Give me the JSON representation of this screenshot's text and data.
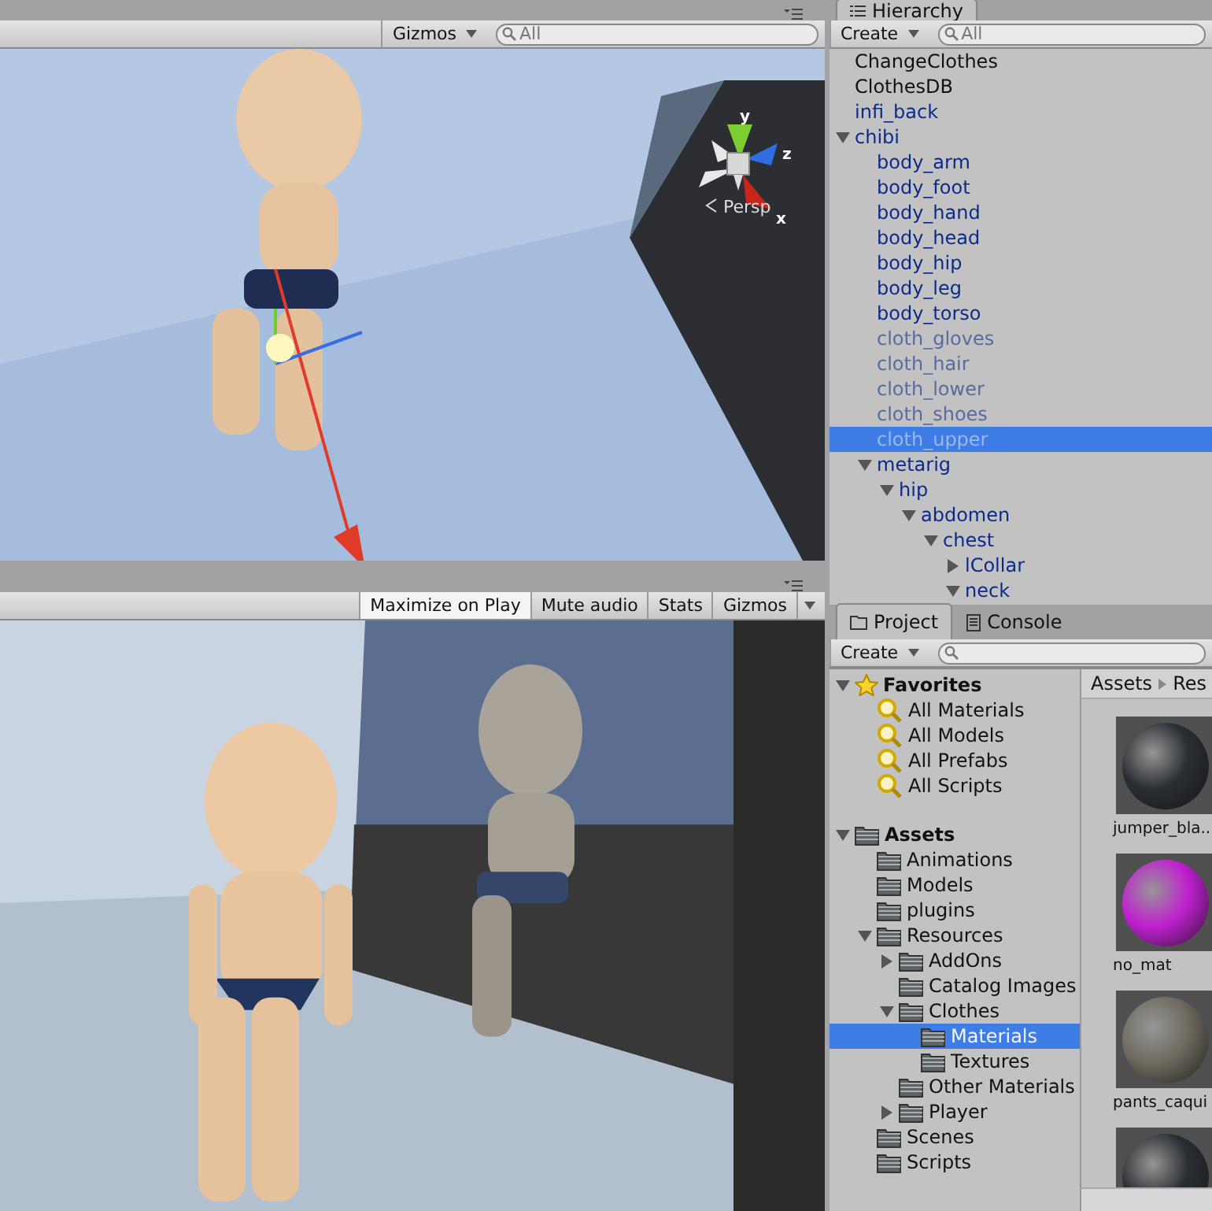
{
  "scene": {
    "toolbar": {
      "gizmos": "Gizmos",
      "search": "All"
    },
    "gizmo_labels": {
      "y": "y",
      "z": "z",
      "x": "x"
    },
    "projection": "Persp"
  },
  "game": {
    "buttons": [
      {
        "label": "Maximize on Play",
        "selected": true
      },
      {
        "label": "Mute audio",
        "selected": false
      },
      {
        "label": "Stats",
        "selected": false
      },
      {
        "label": "Gizmos",
        "selected": false,
        "dropdown": true
      }
    ]
  },
  "hierarchy": {
    "tab": "Hierarchy",
    "create": "Create",
    "search": "All",
    "items": [
      {
        "label": "ChangeClothes",
        "kind": "object"
      },
      {
        "label": "ClothesDB",
        "kind": "object"
      },
      {
        "label": "infi_back",
        "kind": "prefab"
      },
      {
        "label": "chibi",
        "kind": "prefab",
        "expanded": true,
        "children": [
          {
            "label": "body_arm",
            "kind": "prefab"
          },
          {
            "label": "body_foot",
            "kind": "prefab"
          },
          {
            "label": "body_hand",
            "kind": "prefab"
          },
          {
            "label": "body_head",
            "kind": "prefab"
          },
          {
            "label": "body_hip",
            "kind": "prefab"
          },
          {
            "label": "body_leg",
            "kind": "prefab"
          },
          {
            "label": "body_torso",
            "kind": "prefab"
          },
          {
            "label": "cloth_gloves",
            "kind": "inactive"
          },
          {
            "label": "cloth_hair",
            "kind": "inactive"
          },
          {
            "label": "cloth_lower",
            "kind": "inactive"
          },
          {
            "label": "cloth_shoes",
            "kind": "inactive"
          },
          {
            "label": "cloth_upper",
            "kind": "inactive",
            "selected": true
          },
          {
            "label": "metarig",
            "kind": "prefab",
            "expanded": true,
            "children": [
              {
                "label": "hip",
                "kind": "prefab",
                "expanded": true,
                "children": [
                  {
                    "label": "abdomen",
                    "kind": "prefab",
                    "expanded": true,
                    "children": [
                      {
                        "label": "chest",
                        "kind": "prefab",
                        "expanded": true,
                        "children": [
                          {
                            "label": "lCollar",
                            "kind": "prefab",
                            "expanded": false
                          },
                          {
                            "label": "neck",
                            "kind": "prefab",
                            "expanded": true
                          }
                        ]
                      }
                    ]
                  }
                ]
              }
            ]
          }
        ]
      }
    ]
  },
  "project": {
    "tabs": [
      {
        "label": "Project",
        "selected": true
      },
      {
        "label": "Console",
        "selected": false
      }
    ],
    "create": "Create",
    "tree": [
      {
        "label": "Favorites",
        "kind": "favorites",
        "expanded": true,
        "children": [
          {
            "label": "All Materials",
            "kind": "search"
          },
          {
            "label": "All Models",
            "kind": "search"
          },
          {
            "label": "All Prefabs",
            "kind": "search"
          },
          {
            "label": "All Scripts",
            "kind": "search"
          }
        ]
      },
      {
        "label": "Assets",
        "kind": "root",
        "expanded": true,
        "children": [
          {
            "label": "Animations",
            "kind": "folder"
          },
          {
            "label": "Models",
            "kind": "folder"
          },
          {
            "label": "plugins",
            "kind": "folder"
          },
          {
            "label": "Resources",
            "kind": "folder",
            "expanded": true,
            "children": [
              {
                "label": "AddOns",
                "kind": "folder",
                "expanded": false
              },
              {
                "label": "Catalog Images",
                "kind": "folder"
              },
              {
                "label": "Clothes",
                "kind": "folder",
                "expanded": true,
                "children": [
                  {
                    "label": "Materials",
                    "kind": "folder",
                    "selected": true
                  },
                  {
                    "label": "Textures",
                    "kind": "folder"
                  }
                ]
              },
              {
                "label": "Other Materials",
                "kind": "folder"
              },
              {
                "label": "Player",
                "kind": "folder",
                "expanded": false
              }
            ]
          },
          {
            "label": "Scenes",
            "kind": "folder"
          },
          {
            "label": "Scripts",
            "kind": "folder"
          }
        ]
      }
    ],
    "breadcrumb": [
      "Assets",
      "Res"
    ],
    "assets": [
      {
        "label": "jumper_bla...",
        "color": "#2a2e33"
      },
      {
        "label": "no_mat",
        "color": "#c020d0"
      },
      {
        "label": "pants_caqui",
        "color": "#6e6a60"
      },
      {
        "color": "#2a2e33"
      }
    ]
  }
}
